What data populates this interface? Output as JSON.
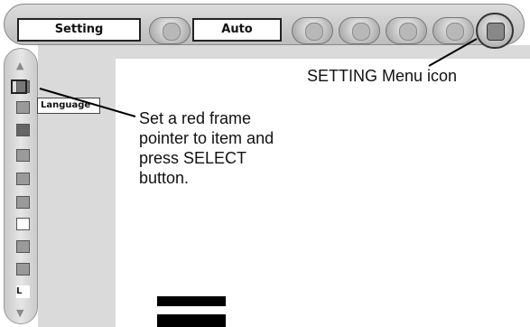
{
  "menu_bar": {
    "setting_label": "Setting",
    "mode_label": "Auto",
    "icons": [
      "input-icon",
      "image-adjust-icon",
      "color-icon",
      "screen-icon",
      "sound-icon",
      "setting-menu-icon"
    ]
  },
  "sidebar": {
    "popup_label": "Language",
    "icons": [
      "scroll-up-icon",
      "language-icon",
      "keystone-icon",
      "ceiling-icon",
      "rear-icon",
      "terminal-icon",
      "power-management-icon",
      "lamp-icon",
      "filter-icon",
      "key-lock-icon",
      "pin-code-icon",
      "remote-icon",
      "scroll-down-icon"
    ]
  },
  "annotations": {
    "menu_icon_caption": "SETTING Menu icon",
    "instruction": "Set a red frame\npointer to item and\npress SELECT\nbutton."
  }
}
